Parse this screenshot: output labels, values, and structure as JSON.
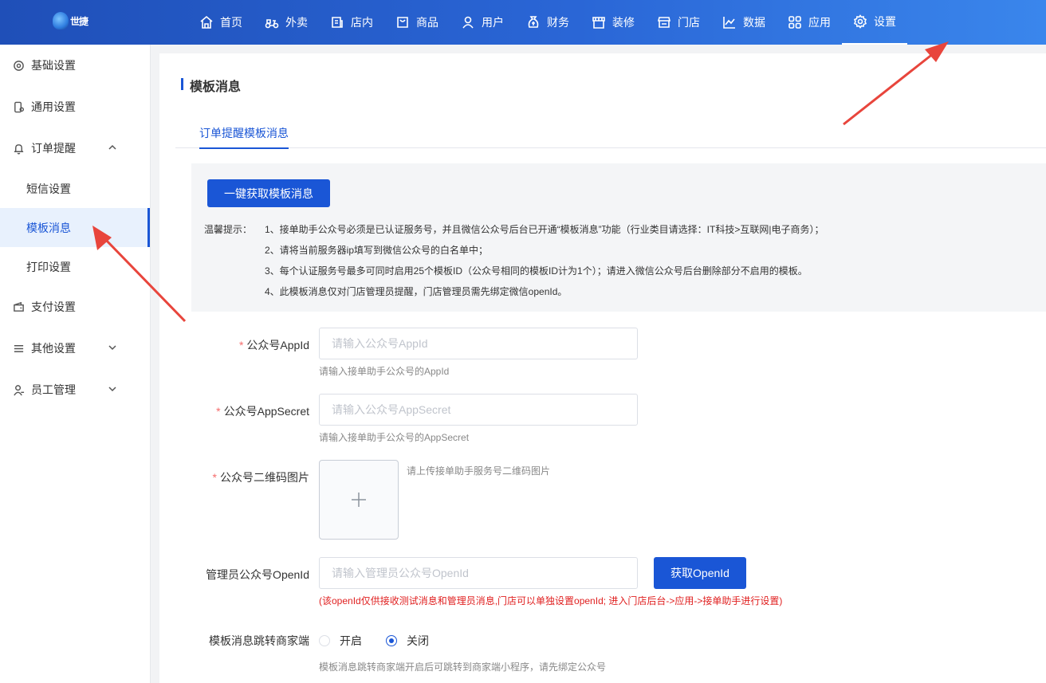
{
  "app": {
    "logo_text": "世捷"
  },
  "nav": {
    "items": [
      {
        "label": "首页",
        "icon": "home-icon"
      },
      {
        "label": "外卖",
        "icon": "scooter-icon"
      },
      {
        "label": "店内",
        "icon": "store-icon"
      },
      {
        "label": "商品",
        "icon": "bag-icon"
      },
      {
        "label": "用户",
        "icon": "user-icon"
      },
      {
        "label": "财务",
        "icon": "money-bag-icon"
      },
      {
        "label": "装修",
        "icon": "shop-decor-icon"
      },
      {
        "label": "门店",
        "icon": "storefront-icon"
      },
      {
        "label": "数据",
        "icon": "chart-icon"
      },
      {
        "label": "应用",
        "icon": "apps-icon"
      },
      {
        "label": "设置",
        "icon": "gear-icon"
      }
    ],
    "active": "设置"
  },
  "sidebar": {
    "items": [
      {
        "label": "基础设置",
        "icon": "gear-icon"
      },
      {
        "label": "通用设置",
        "icon": "phone-settings-icon"
      },
      {
        "label": "订单提醒",
        "icon": "bell-icon",
        "expanded": true,
        "children": [
          {
            "label": "短信设置"
          },
          {
            "label": "模板消息",
            "active": true
          },
          {
            "label": "打印设置"
          }
        ]
      },
      {
        "label": "支付设置",
        "icon": "wallet-icon"
      },
      {
        "label": "其他设置",
        "icon": "list-icon",
        "expanded": false
      },
      {
        "label": "员工管理",
        "icon": "staff-icon",
        "expanded": false
      }
    ]
  },
  "page": {
    "title": "模板消息",
    "tab": "订单提醒模板消息",
    "fetch_button": "一键获取模板消息",
    "tips": {
      "label": "温馨提示：",
      "lines": [
        "1、接单助手公众号必须是已认证服务号，并且微信公众号后台已开通“模板消息”功能（行业类目请选择：IT科技>互联网|电子商务）；",
        "2、请将当前服务器ip填写到微信公众号的白名单中；",
        "3、每个认证服务号最多可同时启用25个模板ID（公众号相同的模板ID计为1个）；请进入微信公众号后台删除部分不启用的模板。",
        "4、此模板消息仅对门店管理员提醒，门店管理员需先绑定微信openId。"
      ]
    },
    "form": {
      "appid": {
        "label": "公众号AppId",
        "placeholder": "请输入公众号AppId",
        "hint": "请输入接单助手公众号的AppId",
        "value": ""
      },
      "appsecret": {
        "label": "公众号AppSecret",
        "placeholder": "请输入公众号AppSecret",
        "hint": "请输入接单助手公众号的AppSecret",
        "value": ""
      },
      "qrcode": {
        "label": "公众号二维码图片",
        "hint": "请上传接单助手服务号二维码图片"
      },
      "openid": {
        "label": "管理员公众号OpenId",
        "placeholder": "请输入管理员公众号OpenId",
        "button": "获取OpenId",
        "warning": "(该openId仅供接收测试消息和管理员消息,门店可以单独设置openId; 进入门店后台->应用->接单助手进行设置)",
        "value": ""
      },
      "jump": {
        "label": "模板消息跳转商家端",
        "options": [
          "开启",
          "关闭"
        ],
        "selected": "关闭",
        "hint": "模板消息跳转商家端开启后可跳转到商家端小程序，请先绑定公众号"
      }
    }
  },
  "colors": {
    "primary": "#1a56d6",
    "topbar_start": "#1f4fb8",
    "topbar_end": "#3a86ec",
    "required": "#f56c6c",
    "warning": "#e02020",
    "annotation": "#e8453c"
  }
}
